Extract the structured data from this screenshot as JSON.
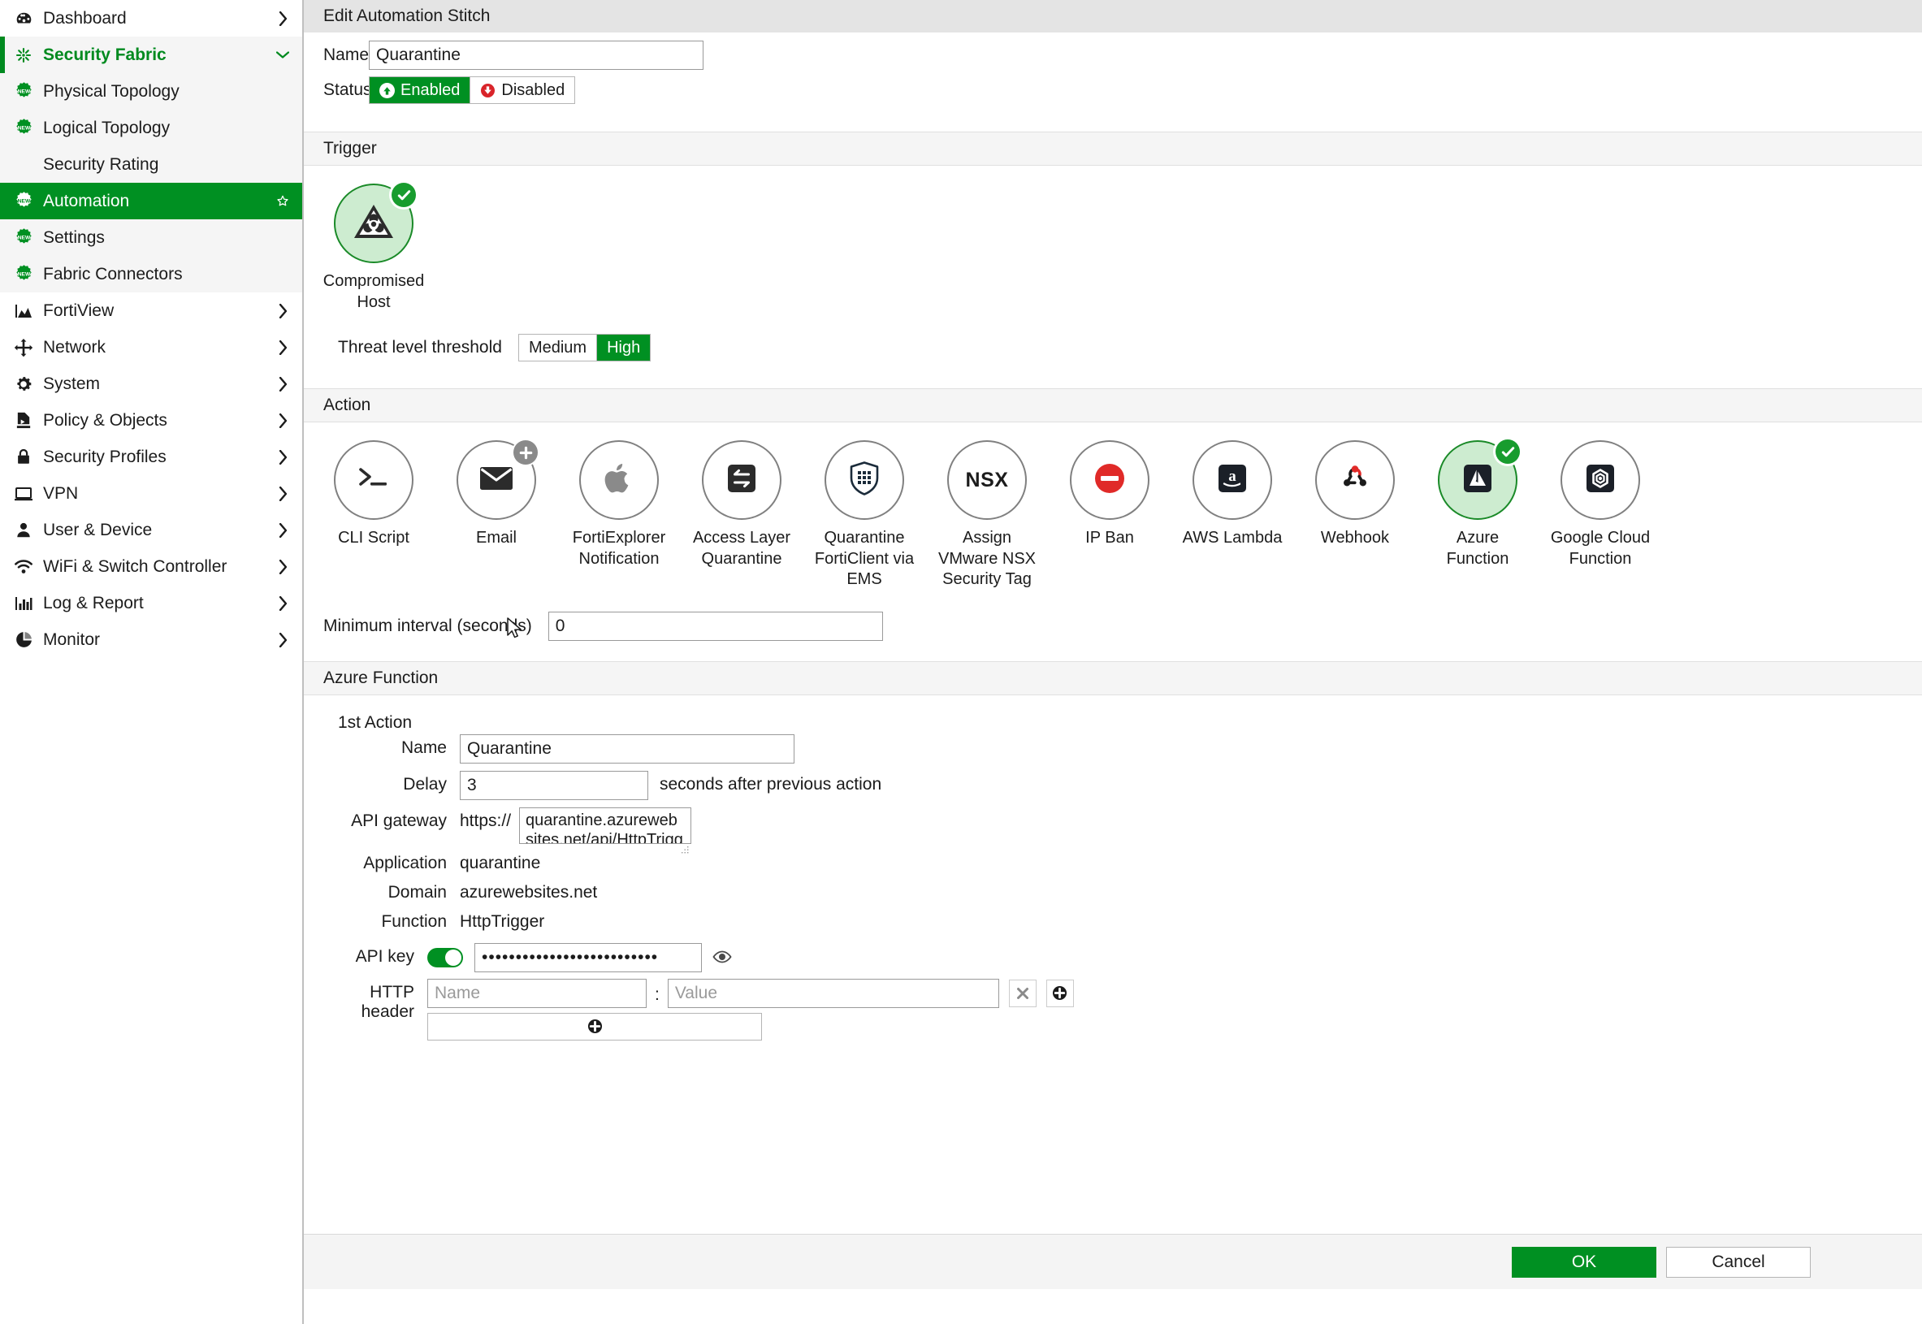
{
  "sidebar": {
    "items": [
      {
        "label": "Dashboard",
        "icon": "dashboard-icon",
        "chevron": "right",
        "state": "normal"
      },
      {
        "label": "Security Fabric",
        "icon": "security-fabric-icon",
        "chevron": "down",
        "state": "expanded"
      },
      {
        "label": "Physical Topology",
        "icon": "new-badge-icon",
        "chevron": "",
        "state": "shade"
      },
      {
        "label": "Logical Topology",
        "icon": "new-badge-icon",
        "chevron": "",
        "state": "shade"
      },
      {
        "label": "Security Rating",
        "icon": "",
        "chevron": "",
        "state": "shade"
      },
      {
        "label": "Automation",
        "icon": "new-badge-icon",
        "chevron": "star",
        "state": "active"
      },
      {
        "label": "Settings",
        "icon": "new-badge-icon",
        "chevron": "",
        "state": "shade"
      },
      {
        "label": "Fabric Connectors",
        "icon": "new-badge-icon",
        "chevron": "",
        "state": "shade"
      },
      {
        "label": "FortiView",
        "icon": "fortiview-icon",
        "chevron": "right",
        "state": "normal"
      },
      {
        "label": "Network",
        "icon": "network-icon",
        "chevron": "right",
        "state": "normal"
      },
      {
        "label": "System",
        "icon": "gear-icon",
        "chevron": "right",
        "state": "normal"
      },
      {
        "label": "Policy & Objects",
        "icon": "policy-icon",
        "chevron": "right",
        "state": "normal"
      },
      {
        "label": "Security Profiles",
        "icon": "lock-icon",
        "chevron": "right",
        "state": "normal"
      },
      {
        "label": "VPN",
        "icon": "monitor-icon",
        "chevron": "right",
        "state": "normal"
      },
      {
        "label": "User & Device",
        "icon": "user-icon",
        "chevron": "right",
        "state": "normal"
      },
      {
        "label": "WiFi & Switch Controller",
        "icon": "wifi-icon",
        "chevron": "right",
        "state": "normal"
      },
      {
        "label": "Log & Report",
        "icon": "bar-chart-icon",
        "chevron": "right",
        "state": "normal"
      },
      {
        "label": "Monitor",
        "icon": "pie-chart-icon",
        "chevron": "right",
        "state": "normal"
      }
    ]
  },
  "dialog": {
    "title": "Edit Automation Stitch",
    "name_label": "Name",
    "name_value": "Quarantine",
    "status_label": "Status",
    "status_enabled": "Enabled",
    "status_disabled": "Disabled",
    "status_selected": "Enabled"
  },
  "trigger": {
    "section_title": "Trigger",
    "tile_label": "Compromised\nHost",
    "tile_icon": "biohazard-warning-icon",
    "tile_selected": true,
    "threshold_label": "Threat level threshold",
    "threshold_options": [
      "Medium",
      "High"
    ],
    "threshold_selected": "High"
  },
  "action": {
    "section_title": "Action",
    "items": [
      {
        "label": "CLI Script",
        "icon": "terminal-icon",
        "selected": false,
        "badge": ""
      },
      {
        "label": "Email",
        "icon": "envelope-icon",
        "selected": false,
        "badge": "plus"
      },
      {
        "label": "FortiExplorer\nNotification",
        "icon": "apple-icon",
        "selected": false,
        "badge": ""
      },
      {
        "label": "Access Layer\nQuarantine",
        "icon": "swap-arrows-icon",
        "selected": false,
        "badge": ""
      },
      {
        "label": "Quarantine\nFortiClient via\nEMS",
        "icon": "shield-grid-icon",
        "selected": false,
        "badge": ""
      },
      {
        "label": "Assign\nVMware NSX\nSecurity Tag",
        "icon": "nsx-text-icon",
        "selected": false,
        "badge": ""
      },
      {
        "label": "IP Ban",
        "icon": "no-entry-icon",
        "selected": false,
        "badge": ""
      },
      {
        "label": "AWS Lambda",
        "icon": "aws-icon",
        "selected": false,
        "badge": ""
      },
      {
        "label": "Webhook",
        "icon": "webhook-icon",
        "selected": false,
        "badge": ""
      },
      {
        "label": "Azure\nFunction",
        "icon": "azure-icon",
        "selected": true,
        "badge": "check"
      },
      {
        "label": "Google Cloud\nFunction",
        "icon": "google-cloud-icon",
        "selected": false,
        "badge": ""
      }
    ],
    "min_interval_label": "Minimum interval (seconds)",
    "min_interval_value": "0"
  },
  "azure": {
    "section_title": "Azure Function",
    "first_action_label": "1st Action",
    "name_label": "Name",
    "name_value": "Quarantine",
    "delay_label": "Delay",
    "delay_value": "3",
    "delay_suffix": "seconds after previous action",
    "gateway_label": "API gateway",
    "gateway_scheme": "https://",
    "gateway_value": "quarantine.azurewebsites.net/api/HttpTrigger",
    "application_label": "Application",
    "application_value": "quarantine",
    "domain_label": "Domain",
    "domain_value": "azurewebsites.net",
    "function_label": "Function",
    "function_value": "HttpTrigger",
    "apikey_label": "API key",
    "apikey_value": "••••••••••••••••••••••••••",
    "apikey_enabled": true,
    "http_header_label": "HTTP header",
    "http_header_name_placeholder": "Name",
    "http_header_value_placeholder": "Value",
    "http_header_separator": ":"
  },
  "footer": {
    "ok_label": "OK",
    "cancel_label": "Cancel"
  },
  "colors": {
    "accent_green": "#009022",
    "selected_tile_fill": "#cdecd0",
    "selected_tile_border": "#1a8a28",
    "danger_red": "#d9242a",
    "section_bg": "#f5f5f5",
    "title_bg": "#e4e4e4"
  }
}
